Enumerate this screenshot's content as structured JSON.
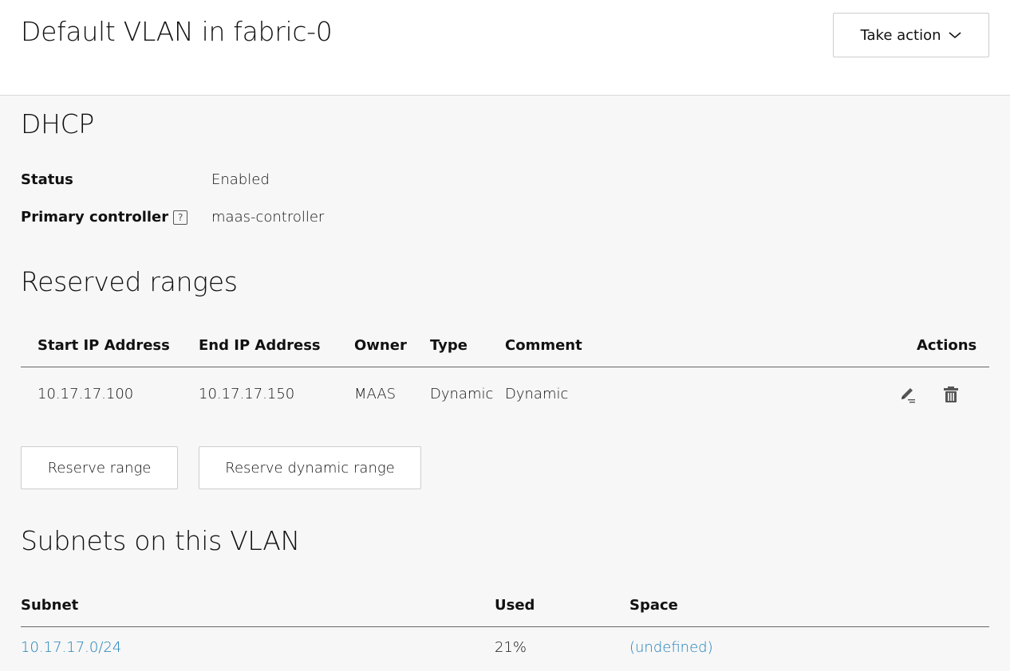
{
  "header": {
    "title": "Default VLAN in fabric-0",
    "take_action_label": "Take action"
  },
  "dhcp": {
    "heading": "DHCP",
    "status_label": "Status",
    "status_value": "Enabled",
    "primary_label": "Primary controller",
    "primary_help": "?",
    "primary_value": "maas-controller"
  },
  "reserved": {
    "heading": "Reserved ranges",
    "columns": [
      "Start IP Address",
      "End IP Address",
      "Owner",
      "Type",
      "Comment",
      "Actions"
    ],
    "rows": [
      {
        "start": "10.17.17.100",
        "end": "10.17.17.150",
        "owner": "MAAS",
        "type": "Dynamic",
        "comment": "Dynamic",
        "actions": [
          "edit-icon",
          "delete-icon"
        ]
      }
    ],
    "reserve_range_label": "Reserve range",
    "reserve_dynamic_label": "Reserve dynamic range"
  },
  "subnets": {
    "heading": "Subnets on this VLAN",
    "columns": [
      "Subnet",
      "Used",
      "Space"
    ],
    "rows": [
      {
        "subnet": "10.17.17.0/24",
        "used": "21%",
        "space": "(undefined)"
      }
    ]
  },
  "colors": {
    "link": "#1d7fb8",
    "background": "#f7f7f7",
    "header_background": "#ffffff"
  }
}
